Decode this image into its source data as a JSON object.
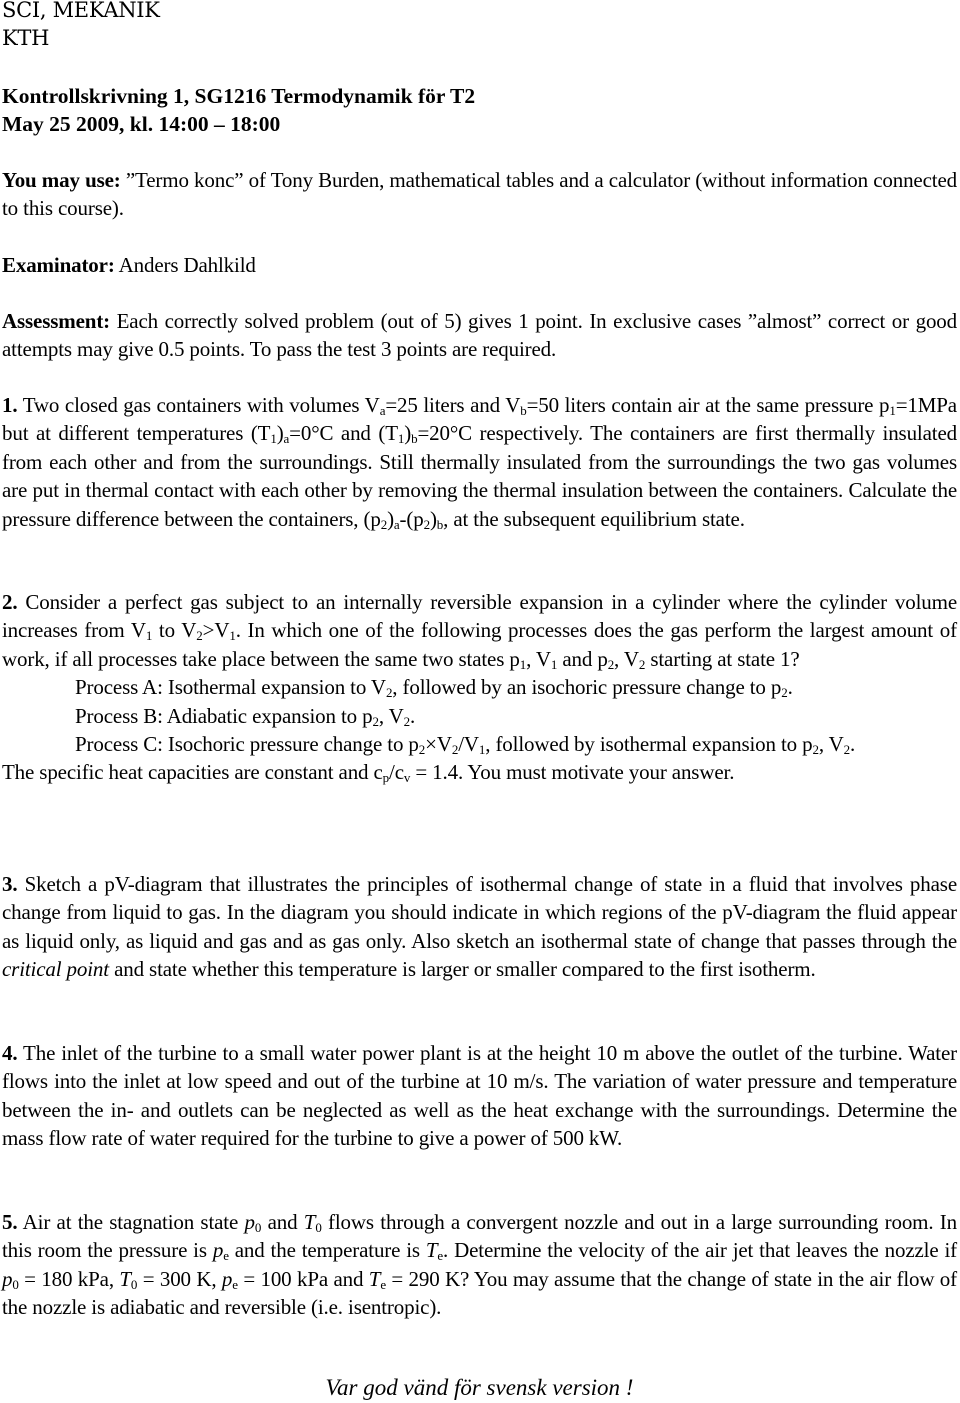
{
  "header": {
    "department": "SCI, MEKANIK",
    "institution": "KTH",
    "exam_title": "Kontrollskrivning 1, SG1216 Termodynamik för T2",
    "exam_date": "May 25 2009, kl. 14:00 – 18:00"
  },
  "info": {
    "allowed": [
      {
        "b": "You may use:"
      },
      {
        "t": " ”Termo konc” of Tony Burden, mathematical tables and a calculator (without information connected to this course)."
      }
    ],
    "examinator": [
      {
        "b": "Examinator:"
      },
      {
        "t": " Anders Dahlkild"
      }
    ],
    "assessment": [
      {
        "b": "Assessment:"
      },
      {
        "t": " Each correctly solved problem (out of 5) gives 1 point. In exclusive cases ”almost” correct or good attempts may give 0.5 points. To pass the test 3 points are required."
      }
    ]
  },
  "problems": [
    {
      "number": "1.",
      "text": [
        {
          "t": " Two closed gas containers with volumes V"
        },
        {
          "sub": "a"
        },
        {
          "t": "=25 liters and V"
        },
        {
          "sub": "b"
        },
        {
          "t": "=50 liters contain air at the same pressure p"
        },
        {
          "sub": "1"
        },
        {
          "t": "=1MPa but at different temperatures (T"
        },
        {
          "sub": "1"
        },
        {
          "t": ")"
        },
        {
          "sub": "a"
        },
        {
          "t": "=0°C and (T"
        },
        {
          "sub": "1"
        },
        {
          "t": ")"
        },
        {
          "sub": "b"
        },
        {
          "t": "=20°C respectively. The containers are first thermally insulated from each other and from the surroundings. Still thermally insulated from the surroundings the two gas volumes are put in thermal contact with each other by removing the thermal insulation between the containers. Calculate the pressure difference between the containers, (p"
        },
        {
          "sub": "2"
        },
        {
          "t": ")"
        },
        {
          "sub": "a"
        },
        {
          "t": "-(p"
        },
        {
          "sub": "2"
        },
        {
          "t": ")"
        },
        {
          "sub": "b"
        },
        {
          "t": ", at the subsequent equilibrium state."
        }
      ]
    },
    {
      "number": "2.",
      "text": [
        {
          "t": " Consider a perfect gas subject to an internally reversible expansion in a cylinder where the cylinder volume increases from V"
        },
        {
          "sub": "1"
        },
        {
          "t": " to V"
        },
        {
          "sub": "2"
        },
        {
          "t": ">V"
        },
        {
          "sub": "1"
        },
        {
          "t": ". In which one of the following processes does the gas perform the largest amount of work, if all processes take place between the same two states p"
        },
        {
          "sub": "1"
        },
        {
          "t": ", V"
        },
        {
          "sub": "1"
        },
        {
          "t": " and p"
        },
        {
          "sub": "2"
        },
        {
          "t": ", V"
        },
        {
          "sub": "2"
        },
        {
          "t": " starting at state 1?"
        }
      ],
      "processes": [
        [
          {
            "t": "Process A: Isothermal expansion to V"
          },
          {
            "sub": "2"
          },
          {
            "t": ", followed by an isochoric pressure change to p"
          },
          {
            "sub": "2"
          },
          {
            "t": "."
          }
        ],
        [
          {
            "t": "Process B: Adiabatic expansion to p"
          },
          {
            "sub": "2"
          },
          {
            "t": ", V"
          },
          {
            "sub": "2"
          },
          {
            "t": "."
          }
        ],
        [
          {
            "t": "Process C: Isochoric pressure change to p"
          },
          {
            "sub": "2"
          },
          {
            "t": "×V"
          },
          {
            "sub": "2"
          },
          {
            "t": "/V"
          },
          {
            "sub": "1"
          },
          {
            "t": ", followed by isothermal expansion to p"
          },
          {
            "sub": "2"
          },
          {
            "t": ", V"
          },
          {
            "sub": "2"
          },
          {
            "t": "."
          }
        ]
      ],
      "closing": [
        {
          "t": "The specific heat capacities are constant and c"
        },
        {
          "sub": "p"
        },
        {
          "t": "/c"
        },
        {
          "sub": "v"
        },
        {
          "t": " = 1.4. You must motivate your answer."
        }
      ]
    },
    {
      "number": "3.",
      "text": [
        {
          "t": " Sketch a pV-diagram that illustrates the principles of isothermal change of state in a fluid that involves phase change from liquid to gas. In the diagram you should indicate in which regions of the pV-diagram the fluid appear as liquid only, as liquid and gas and as gas only. Also sketch an isothermal state of change that passes through the "
        },
        {
          "i": "critical point"
        },
        {
          "t": " and state whether this temperature is larger or smaller compared to the first isotherm."
        }
      ]
    },
    {
      "number": "4.",
      "text": [
        {
          "t": " The inlet of the turbine to a small water power plant is at the height 10 m above the outlet of the turbine. Water flows into the inlet at low speed and out of the turbine at 10 m/s. The variation of water pressure and temperature between the in- and outlets can be neglected as well as the heat exchange with the surroundings. Determine the mass flow rate of water required for the turbine to give a power of 500 kW."
        }
      ]
    },
    {
      "number": "5.",
      "text": [
        {
          "t": " Air at the stagnation state "
        },
        {
          "i": "p"
        },
        {
          "sub": "0"
        },
        {
          "t": " and "
        },
        {
          "i": "T"
        },
        {
          "sub": "0"
        },
        {
          "t": " flows through a convergent nozzle and out in a large surrounding room. In this room the pressure is "
        },
        {
          "i": "p"
        },
        {
          "sub": "e"
        },
        {
          "t": " and the temperature is "
        },
        {
          "i": "T"
        },
        {
          "sub": "e"
        },
        {
          "t": ". Determine the velocity of the air jet that leaves the nozzle if "
        },
        {
          "i": "p"
        },
        {
          "sub": "0"
        },
        {
          "t": " = 180 kPa, "
        },
        {
          "i": "T"
        },
        {
          "sub": "0"
        },
        {
          "t": " = 300 K, "
        },
        {
          "i": "p"
        },
        {
          "sub": "e"
        },
        {
          "t": " = 100 kPa and "
        },
        {
          "i": "T"
        },
        {
          "sub": "e"
        },
        {
          "t": " = 290 K? You may assume that the change of state in the air flow of the nozzle is adiabatic and reversible (i.e. isentropic)."
        }
      ]
    }
  ],
  "footer": {
    "note": "Var god vänd för svensk version !"
  }
}
